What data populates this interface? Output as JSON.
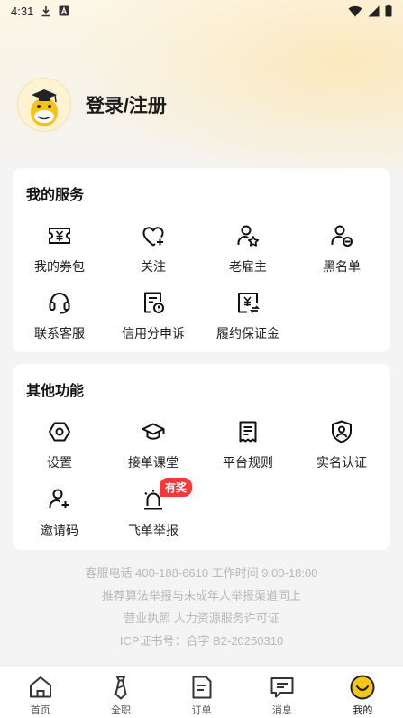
{
  "status_bar": {
    "time": "4:31",
    "icons": [
      "download-icon",
      "notification-a-icon",
      "wifi-icon",
      "signal-icon",
      "battery-icon"
    ]
  },
  "profile": {
    "login_label": "登录/注册",
    "avatar_icon": "mascot-avatar-icon"
  },
  "services": {
    "title": "我的服务",
    "items": [
      {
        "label": "我的券包",
        "icon": "coupon-icon"
      },
      {
        "label": "关注",
        "icon": "heart-plus-icon"
      },
      {
        "label": "老雇主",
        "icon": "user-star-icon"
      },
      {
        "label": "黑名单",
        "icon": "user-block-icon"
      },
      {
        "label": "联系客服",
        "icon": "headset-icon"
      },
      {
        "label": "信用分申诉",
        "icon": "credit-appeal-icon"
      },
      {
        "label": "履约保证金",
        "icon": "deposit-icon"
      }
    ]
  },
  "other": {
    "title": "其他功能",
    "items": [
      {
        "label": "设置",
        "icon": "settings-hex-icon"
      },
      {
        "label": "接单课堂",
        "icon": "graduation-cap-icon"
      },
      {
        "label": "平台规则",
        "icon": "rules-doc-icon"
      },
      {
        "label": "实名认证",
        "icon": "shield-user-icon"
      },
      {
        "label": "邀请码",
        "icon": "user-add-icon"
      },
      {
        "label": "飞单举报",
        "icon": "alarm-icon",
        "badge": "有奖"
      }
    ]
  },
  "footer": {
    "line1": "客服电话 400-188-6610    工作时间 9:00-18:00",
    "line2": "推荐算法举报与未成年人举报渠道同上",
    "line3": "营业执照    人力资源服务许可证",
    "line4": "ICP证书号：合字 B2-20250310"
  },
  "tabs": [
    {
      "label": "首页",
      "icon": "home-icon",
      "active": false
    },
    {
      "label": "全职",
      "icon": "tie-icon",
      "active": false
    },
    {
      "label": "订单",
      "icon": "order-doc-icon",
      "active": false
    },
    {
      "label": "消息",
      "icon": "message-icon",
      "active": false
    },
    {
      "label": "我的",
      "icon": "smiley-icon",
      "active": true
    }
  ],
  "colors": {
    "accent": "#f5c518",
    "badge": "#f23a3a",
    "footer_text": "#b8b8b8"
  }
}
